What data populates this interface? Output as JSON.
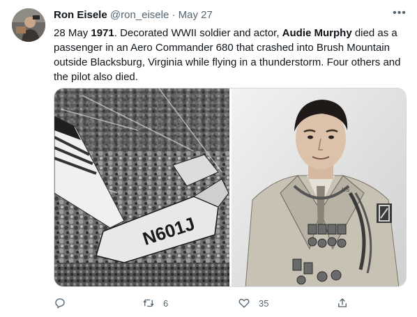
{
  "author": {
    "name": "Ron Eisele",
    "handle": "@ron_eisele",
    "separator": "·",
    "date": "May 27",
    "avatar_icon": "profile-photo"
  },
  "tweet": {
    "parts": {
      "p1": "28 May ",
      "p2": "1971",
      "p3": ". Decorated WWII soldier and actor, ",
      "p4": "Audie Murphy",
      "p5": " died as a passenger in an Aero Commander 680 that crashed into Brush Mountain outside Blacksburg, Virginia while flying in a thunderstorm. Four others and the pilot also died."
    }
  },
  "media": {
    "left_photo": {
      "tail_number": "N601J"
    },
    "right_photo": {
      "collar_text": "US"
    }
  },
  "actions": {
    "reply_icon": "reply-icon",
    "retweet_count": "6",
    "like_count": "35",
    "share_icon": "share-icon"
  },
  "colors": {
    "text": "#0f1419",
    "secondary": "#536471",
    "border": "#cfd9de"
  }
}
